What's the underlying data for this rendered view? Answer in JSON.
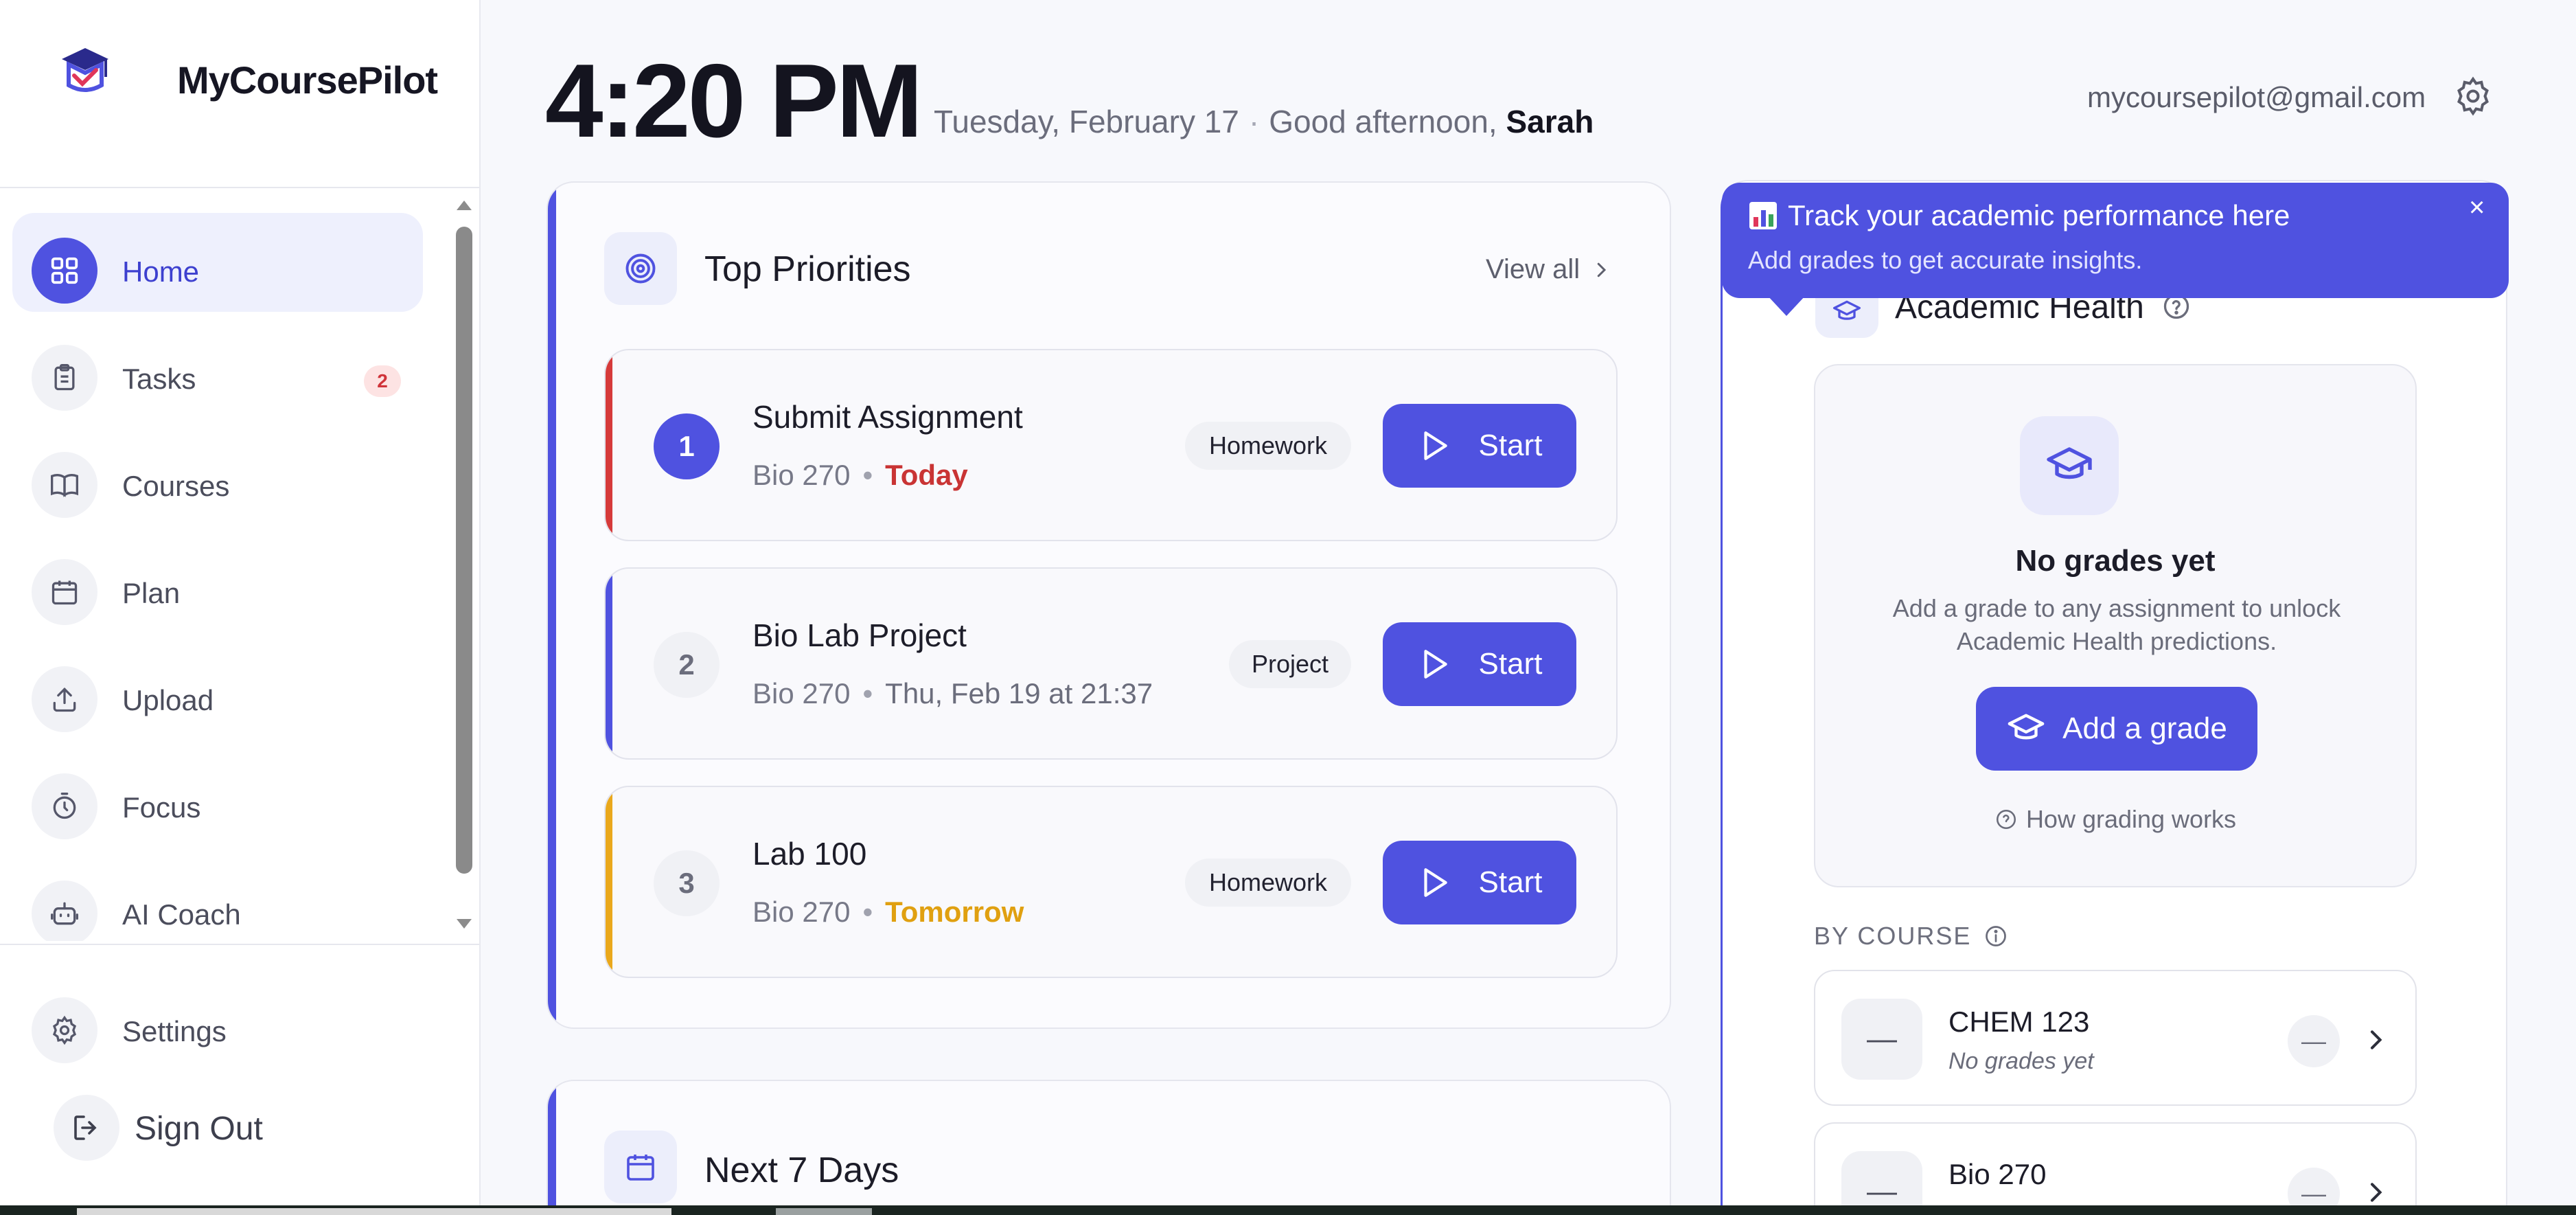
{
  "brand": {
    "name": "MyCoursePilot"
  },
  "sidebar": {
    "items": [
      {
        "label": "Home",
        "icon": "grid-icon",
        "active": true
      },
      {
        "label": "Tasks",
        "icon": "clipboard-icon",
        "badge": "2"
      },
      {
        "label": "Courses",
        "icon": "book-icon"
      },
      {
        "label": "Plan",
        "icon": "calendar-icon"
      },
      {
        "label": "Upload",
        "icon": "upload-icon"
      },
      {
        "label": "Focus",
        "icon": "timer-icon"
      },
      {
        "label": "AI Coach",
        "icon": "robot-icon"
      }
    ],
    "settings_label": "Settings",
    "signout_label": "Sign Out"
  },
  "header": {
    "time": "4:20 PM",
    "date": "Tuesday, February 17",
    "greeting": "Good afternoon,",
    "user": "Sarah",
    "email": "mycoursepilot@gmail.com"
  },
  "priorities": {
    "title": "Top Priorities",
    "view_all": "View all",
    "items": [
      {
        "num": "1",
        "title": "Submit Assignment",
        "course": "Bio 270",
        "due": "Today",
        "tag": "Homework",
        "start": "Start",
        "accent": "#d63a3a",
        "due_color": "#c93434"
      },
      {
        "num": "2",
        "title": "Bio Lab Project",
        "course": "Bio 270",
        "due": "Thu, Feb 19 at 21:37",
        "tag": "Project",
        "start": "Start",
        "accent": "#4f52e0",
        "due_color": "#6b6d7c"
      },
      {
        "num": "3",
        "title": "Lab 100",
        "course": "Bio 270",
        "due": "Tomorrow",
        "tag": "Homework",
        "start": "Start",
        "accent": "#eaa81c",
        "due_color": "#e0a010"
      }
    ]
  },
  "next7": {
    "title": "Next 7 Days"
  },
  "tooltip": {
    "title": "Track your academic performance here",
    "subtitle": "Add grades to get accurate insights.",
    "close": "×"
  },
  "health": {
    "title": "Academic Health",
    "empty_title": "No grades yet",
    "empty_desc": "Add a grade to any assignment to unlock Academic Health predictions.",
    "add_grade": "Add a grade",
    "how": "How grading works",
    "by_course": "BY COURSE",
    "courses": [
      {
        "name": "CHEM 123",
        "status": "No grades yet",
        "avatar": "—",
        "minus": "—"
      },
      {
        "name": "Bio 270",
        "status": "",
        "avatar": "—",
        "minus": "—"
      }
    ]
  },
  "colors": {
    "accent": "#4f52e0",
    "danger": "#d63a3a",
    "warning": "#eaa81c"
  }
}
